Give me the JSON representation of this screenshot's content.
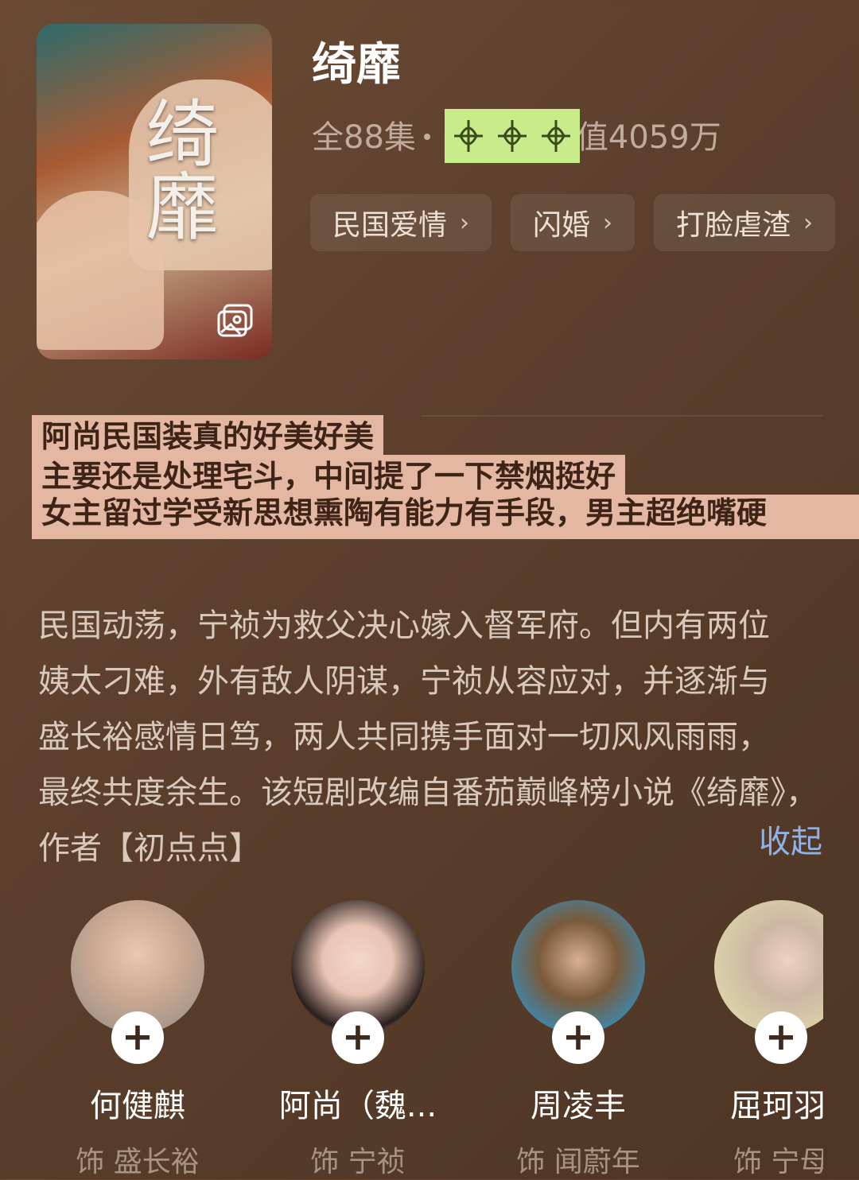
{
  "drama": {
    "title": "绮靡",
    "episodes": "全88集",
    "popularity": "值4059万",
    "poster_calligraphy": "绮靡",
    "tags": [
      {
        "label": "民国爱情"
      },
      {
        "label": "闪婚"
      },
      {
        "label": "打脸虐渣"
      }
    ]
  },
  "highlights": [
    "阿尚民国装真的好美好美",
    "主要还是处理宅斗，中间提了一下禁烟挺好",
    "女主留过学受新思想熏陶有能力有手段，男主超绝嘴硬"
  ],
  "description": {
    "lines": [
      "民国动荡，宁祯为救父决心嫁入督军府。但内有两位",
      "姨太刁难，外有敌人阴谋，宁祯从容应对，并逐渐与",
      "盛长裕感情日笃，两人共同携手面对一切风风雨雨，",
      "最终共度余生。该短剧改编自番茄巅峰榜小说《绮靡》，",
      "作者【初点点】"
    ],
    "collapse_label": "收起"
  },
  "cast": [
    {
      "name": "何健麒",
      "role": "饰 盛长裕"
    },
    {
      "name": "阿尚（魏...",
      "role": "饰 宁祯"
    },
    {
      "name": "周凌丰",
      "role": "饰 闻蔚年"
    },
    {
      "name": "屈珂羽",
      "role": "饰 宁母"
    }
  ],
  "colors": {
    "background": "#5b3f2c",
    "highlight": "#e4b7a3",
    "link": "#8fb3e8"
  }
}
